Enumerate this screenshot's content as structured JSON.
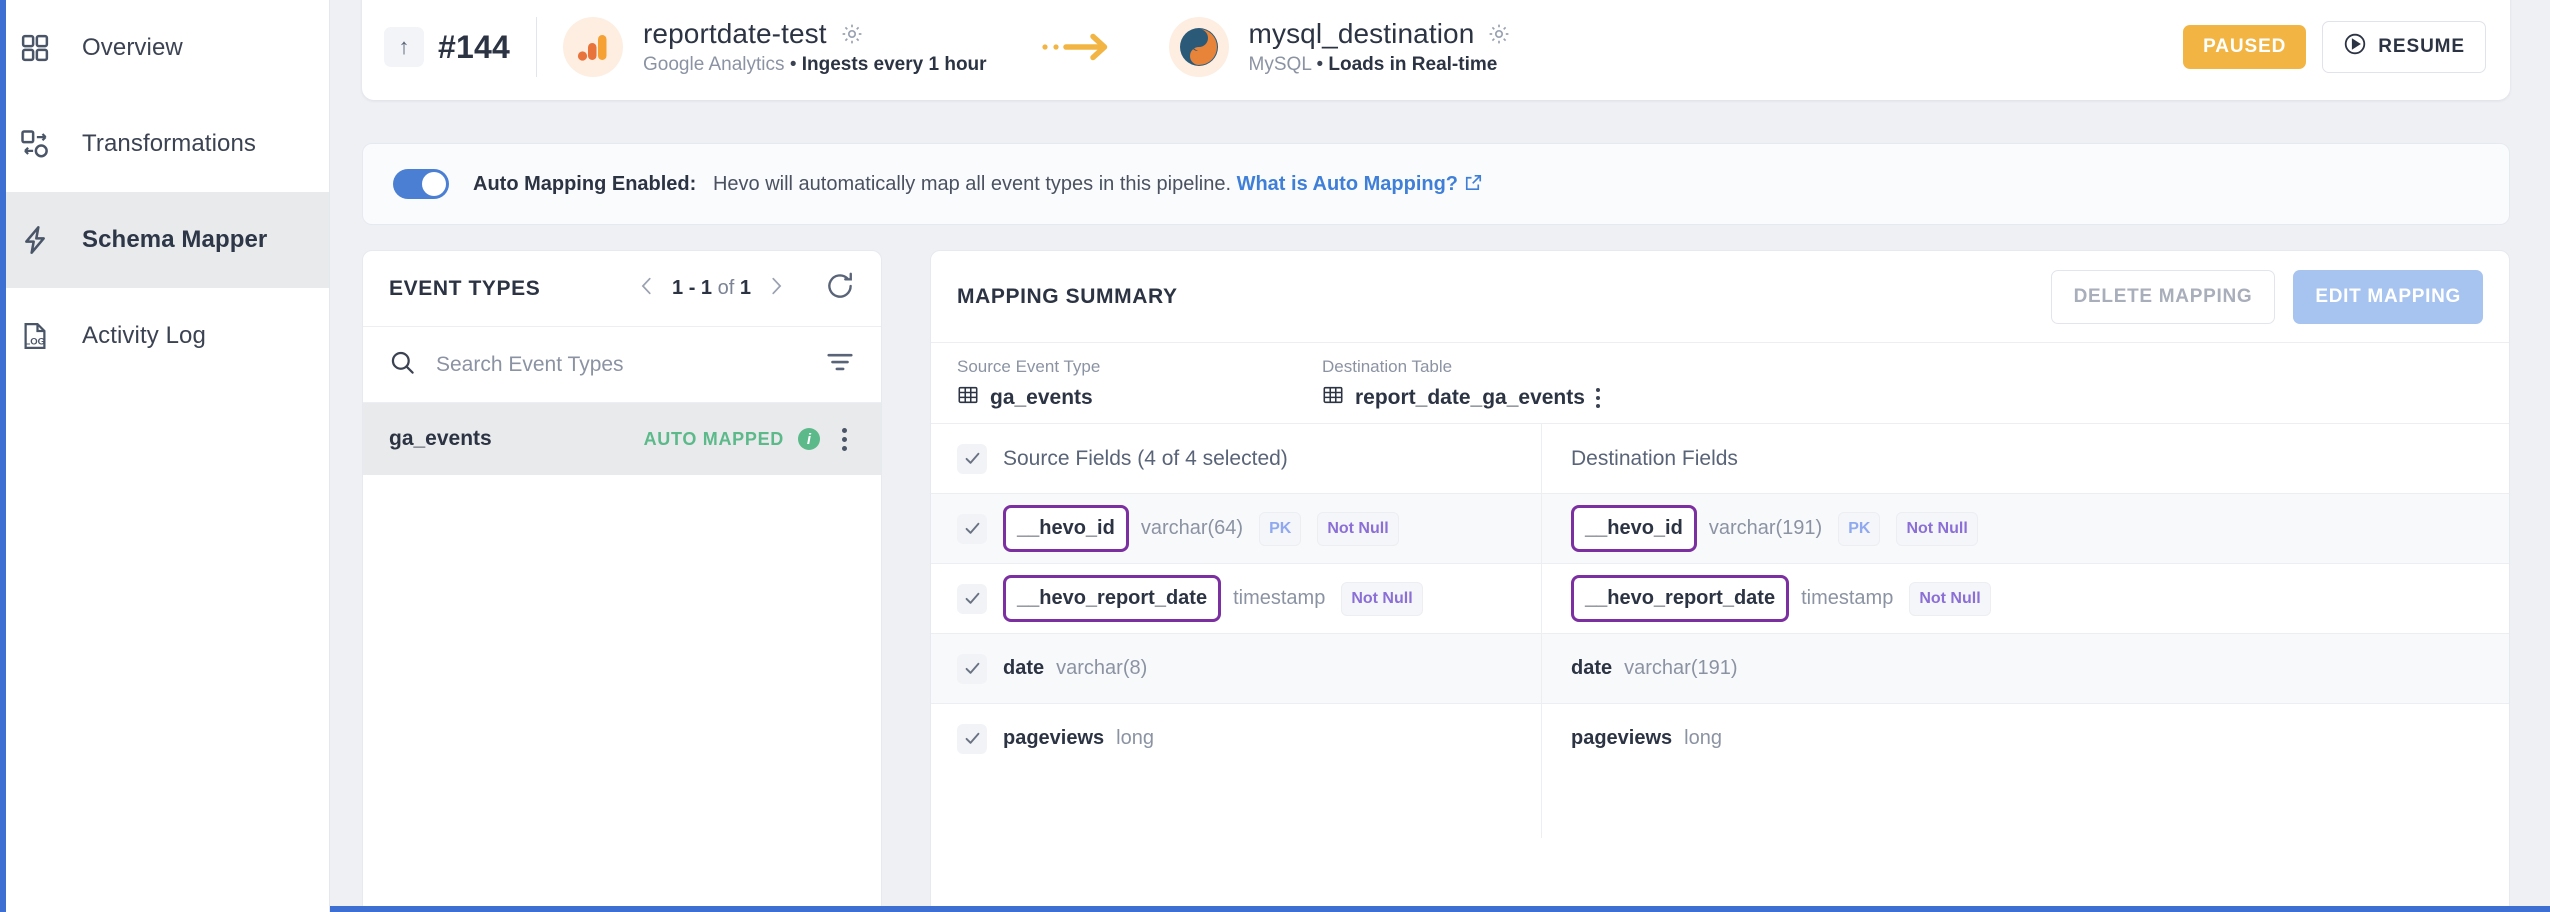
{
  "sidebar": {
    "items": [
      {
        "label": "Overview",
        "icon": "grid-icon",
        "active": false
      },
      {
        "label": "Transformations",
        "icon": "transform-icon",
        "active": false
      },
      {
        "label": "Schema Mapper",
        "icon": "lightning-icon",
        "active": true
      },
      {
        "label": "Activity Log",
        "icon": "log-document-icon",
        "active": false
      }
    ]
  },
  "header": {
    "run_id": "#144",
    "up_arrow_icon": "arrow-up-icon",
    "source": {
      "name": "reportdate-test",
      "type": "Google Analytics",
      "separator": "•",
      "schedule": "Ingests every 1 hour",
      "logo": "google-analytics-logo",
      "settings_icon": "gear-icon"
    },
    "flow_icon": "dashed-arrow-right-icon",
    "destination": {
      "name": "mysql_destination",
      "type": "MySQL",
      "separator": "•",
      "schedule": "Loads in Real-time",
      "logo": "mysql-logo",
      "settings_icon": "gear-icon"
    },
    "status_badge": "PAUSED",
    "resume_label": "RESUME",
    "resume_icon": "play-circle-icon",
    "colors": {
      "paused": "#f2b544",
      "accent": "#3c6fd1"
    }
  },
  "auto_mapping": {
    "toggle_on": true,
    "title": "Auto Mapping Enabled:",
    "description": "Hevo will automatically map all event types in this pipeline.",
    "link_text": "What is Auto Mapping?",
    "link_icon": "external-link-icon"
  },
  "event_types": {
    "panel_title": "EVENT TYPES",
    "pager": {
      "range": "1 - 1",
      "of_word": "of",
      "total": "1",
      "prev_icon": "chevron-left-icon",
      "next_icon": "chevron-right-icon"
    },
    "refresh_icon": "refresh-icon",
    "search": {
      "placeholder": "Search Event Types",
      "value": "",
      "icon": "search-icon",
      "filter_icon": "filter-icon"
    },
    "rows": [
      {
        "name": "ga_events",
        "status": "AUTO MAPPED",
        "info_icon": "info-icon",
        "menu_icon": "kebab-menu-icon",
        "selected": true
      }
    ]
  },
  "mapping_summary": {
    "panel_title": "MAPPING SUMMARY",
    "delete_label": "DELETE MAPPING",
    "edit_label": "EDIT MAPPING",
    "source_event_type": {
      "label": "Source Event Type",
      "value": "ga_events",
      "icon": "table-icon"
    },
    "destination_table": {
      "label": "Destination Table",
      "value": "report_date_ga_events",
      "icon": "table-icon",
      "menu_icon": "kebab-menu-icon"
    },
    "columns": {
      "source_header": "Source Fields (4 of 4 selected)",
      "destination_header": "Destination Fields"
    },
    "fields": [
      {
        "checked": true,
        "source": {
          "name": "__hevo_id",
          "type": "varchar(64)",
          "tags": [
            "PK",
            "Not Null"
          ],
          "highlighted": true
        },
        "destination": {
          "name": "__hevo_id",
          "type": "varchar(191)",
          "tags": [
            "PK",
            "Not Null"
          ],
          "highlighted": true
        }
      },
      {
        "checked": true,
        "source": {
          "name": "__hevo_report_date",
          "type": "timestamp",
          "tags": [
            "Not Null"
          ],
          "highlighted": true
        },
        "destination": {
          "name": "__hevo_report_date",
          "type": "timestamp",
          "tags": [
            "Not Null"
          ],
          "highlighted": true
        }
      },
      {
        "checked": true,
        "source": {
          "name": "date",
          "type": "varchar(8)",
          "tags": [],
          "highlighted": false
        },
        "destination": {
          "name": "date",
          "type": "varchar(191)",
          "tags": [],
          "highlighted": false
        }
      },
      {
        "checked": true,
        "source": {
          "name": "pageviews",
          "type": "long",
          "tags": [],
          "highlighted": false
        },
        "destination": {
          "name": "pageviews",
          "type": "long",
          "tags": [],
          "highlighted": false
        }
      }
    ],
    "highlight_color": "#7b2fa0"
  }
}
